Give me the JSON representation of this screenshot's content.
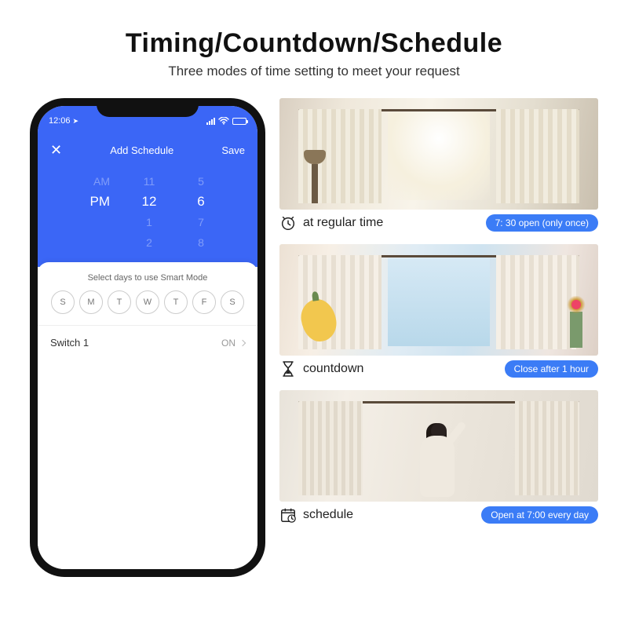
{
  "header": {
    "title": "Timing/Countdown/Schedule",
    "subtitle": "Three modes of time setting to meet your request"
  },
  "phone": {
    "status": {
      "time": "12:06",
      "arrow": "➤"
    },
    "nav": {
      "close": "✕",
      "title": "Add Schedule",
      "save": "Save"
    },
    "picker": {
      "rows": [
        {
          "period": "AM",
          "h": "11",
          "m": "5"
        },
        {
          "period": "PM",
          "h": "12",
          "m": "6"
        },
        {
          "period": "",
          "h": "1",
          "m": "7"
        },
        {
          "period": "",
          "h": "2",
          "m": "8"
        }
      ],
      "selected_index": 1
    },
    "smart_mode_label": "Select days to use Smart Mode",
    "days": [
      "S",
      "M",
      "T",
      "W",
      "T",
      "F",
      "S"
    ],
    "switch": {
      "label": "Switch 1",
      "value": "ON"
    }
  },
  "features": [
    {
      "icon": "clock",
      "label": "at regular time",
      "pill": "7: 30 open (only once)"
    },
    {
      "icon": "hourglass",
      "label": "countdown",
      "pill": "Close after 1 hour"
    },
    {
      "icon": "calendar",
      "label": "schedule",
      "pill": "Open at 7:00 every day"
    }
  ]
}
